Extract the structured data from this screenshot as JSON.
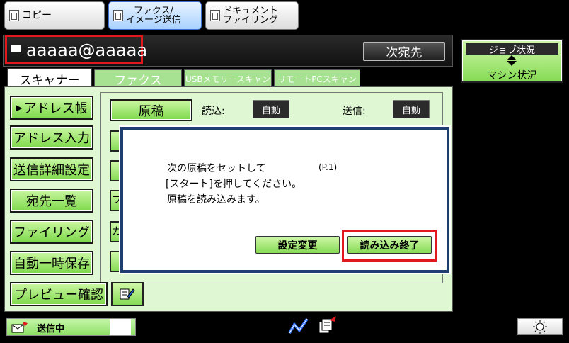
{
  "top_tabs": [
    {
      "label": "コピー"
    },
    {
      "label_line1": "ファクス/",
      "label_line2": "イメージ送信"
    },
    {
      "label_line1": "ドキュメント",
      "label_line2": "ファイリング"
    }
  ],
  "address": {
    "value": "aaaaa@aaaaa",
    "next_button": "次宛先"
  },
  "job_status": {
    "title": "ジョブ状況",
    "subtitle": "マシン状況"
  },
  "mode_tabs": [
    "スキャナー",
    "ファクス",
    "USBメモリースキャン",
    "リモートPCスキャン"
  ],
  "side_buttons": [
    "アドレス帳",
    "アドレス入力",
    "送信詳細設定",
    "宛先一覧",
    "ファイリング",
    "自動一時保存",
    "プレビュー確認"
  ],
  "original": {
    "button": "原稿",
    "read_label": "読込:",
    "read_value": "自動",
    "send_label": "送信:",
    "send_value": "自動"
  },
  "partial_labels": [
    "フ",
    "カ"
  ],
  "dialog": {
    "line1": "次の原稿をセットして",
    "page": "(P.1)",
    "line2": "[スタート]を押してください。",
    "line3": "原稿を読み込みます。",
    "settings_button": "設定変更",
    "finish_button": "読み込み終了"
  },
  "status_bar": {
    "sending": "送信中"
  },
  "colors": {
    "accent_green": "#86db55",
    "highlight": "#e1191e",
    "dialog_border": "#1d3e6e"
  }
}
